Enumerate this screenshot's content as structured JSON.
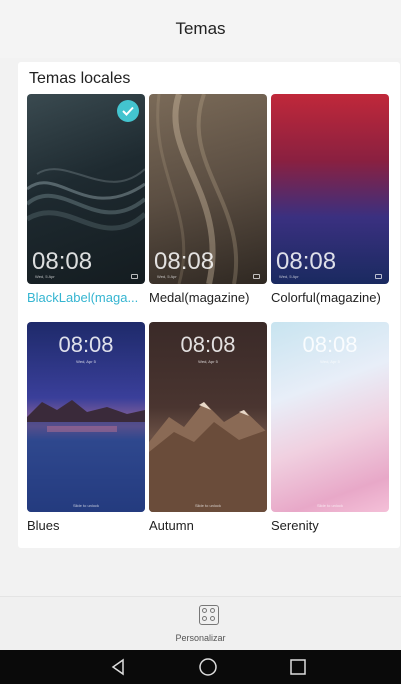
{
  "header": {
    "title": "Temas"
  },
  "section": {
    "title": "Temas locales"
  },
  "themes": [
    {
      "name": "BlackLabel(maga...",
      "time": "08:08",
      "date": "Wed, 5 Apr",
      "selected": true
    },
    {
      "name": "Medal(magazine)",
      "time": "08:08",
      "date": "Wed, 5 Apr",
      "selected": false
    },
    {
      "name": "Colorful(magazine)",
      "time": "08:08",
      "date": "Wed, 5 Apr",
      "selected": false
    },
    {
      "name": "Blues",
      "time": "08:08",
      "date": "Wed, Apr 5",
      "slide": "Slide to unlock",
      "selected": false
    },
    {
      "name": "Autumn",
      "time": "08:08",
      "date": "Wed, Apr 5",
      "slide": "Slide to unlock",
      "selected": false
    },
    {
      "name": "Serenity",
      "time": "08:08",
      "date": "Wed, Apr 5",
      "slide": "Slide to unlock",
      "selected": false
    }
  ],
  "bottom": {
    "label": "Personalizar",
    "icon": "personalize-icon"
  },
  "nav": {
    "back_icon": "back-icon",
    "home_icon": "home-icon",
    "recents_icon": "recents-icon"
  },
  "colors": {
    "accent": "#35b5d1",
    "check": "#43c4cf"
  }
}
